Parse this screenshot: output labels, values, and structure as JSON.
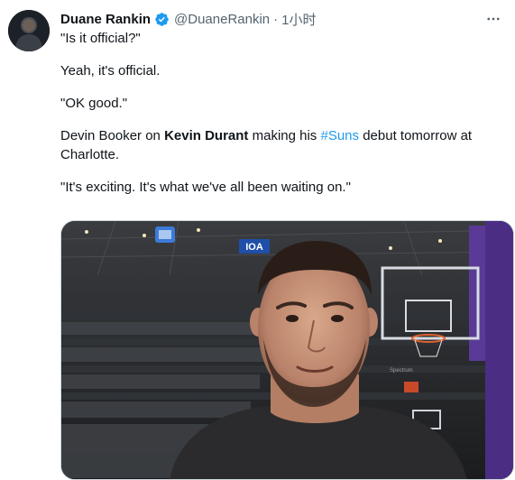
{
  "tweet": {
    "author": {
      "display_name": "Duane Rankin",
      "handle": "@DuaneRankin",
      "verified": true
    },
    "separator": "·",
    "timestamp": "1小时",
    "quote_1": "\"Is it official?\"",
    "line_2": "Yeah, it's official.",
    "quote_3": "\"OK good.\"",
    "line_4": {
      "prefix": "Devin Booker on ",
      "bold_name": "Kevin Durant",
      "middle": " making his ",
      "hashtag": "#Suns",
      "suffix": " debut tomorrow at Charlotte."
    },
    "quote_5": "\"It's exciting. It's what we've all been waiting on.\"",
    "media": {
      "signs": [
        "IOA",
        "Spectrum"
      ]
    }
  },
  "colors": {
    "text": "#0f1419",
    "secondary": "#536471",
    "link": "#1d9bf0",
    "verified_badge": "#1d9bf0"
  },
  "icons": [
    "verified-badge-icon",
    "more-options-icon"
  ]
}
